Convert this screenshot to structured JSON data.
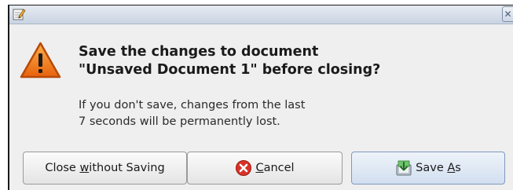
{
  "dialog": {
    "primary_line1": "Save the changes to document",
    "primary_line2": "\"Unsaved Document 1\" before closing?",
    "secondary_line1": "If you don't save, changes from the last",
    "secondary_line2": "7 seconds will be permanently lost."
  },
  "buttons": {
    "close_without_saving": {
      "pre": "Close ",
      "mnemonic": "w",
      "post": "ithout Saving"
    },
    "cancel": {
      "pre": "",
      "mnemonic": "C",
      "post": "ancel"
    },
    "save_as": {
      "pre": "Save ",
      "mnemonic": "A",
      "post": "s"
    }
  },
  "icons": {
    "app": "text-editor-icon",
    "close": "close-icon",
    "warning": "warning-icon",
    "cancel": "cancel-icon",
    "save": "save-icon"
  },
  "colors": {
    "warning_orange": "#f07a18",
    "cancel_red": "#d8322a",
    "save_green": "#3a9a3a"
  }
}
